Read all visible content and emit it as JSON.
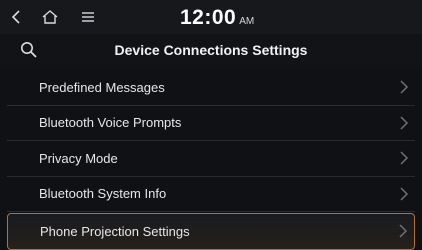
{
  "status_bar": {
    "time": "12:00",
    "ampm": "AM",
    "icons": [
      "back-icon",
      "home-icon",
      "menu-icon"
    ]
  },
  "header": {
    "title": "Device Connections Settings",
    "icon": "search-icon"
  },
  "menu_items": [
    {
      "label": "Predefined Messages",
      "selected": false
    },
    {
      "label": "Bluetooth Voice Prompts",
      "selected": false
    },
    {
      "label": "Privacy Mode",
      "selected": false
    },
    {
      "label": "Bluetooth System Info",
      "selected": false
    },
    {
      "label": "Phone Projection Settings",
      "selected": true
    }
  ],
  "colors": {
    "background": "#101114",
    "selected_border": "#b96e35",
    "text": "#e5e7ea",
    "chevron": "#6e7075"
  }
}
